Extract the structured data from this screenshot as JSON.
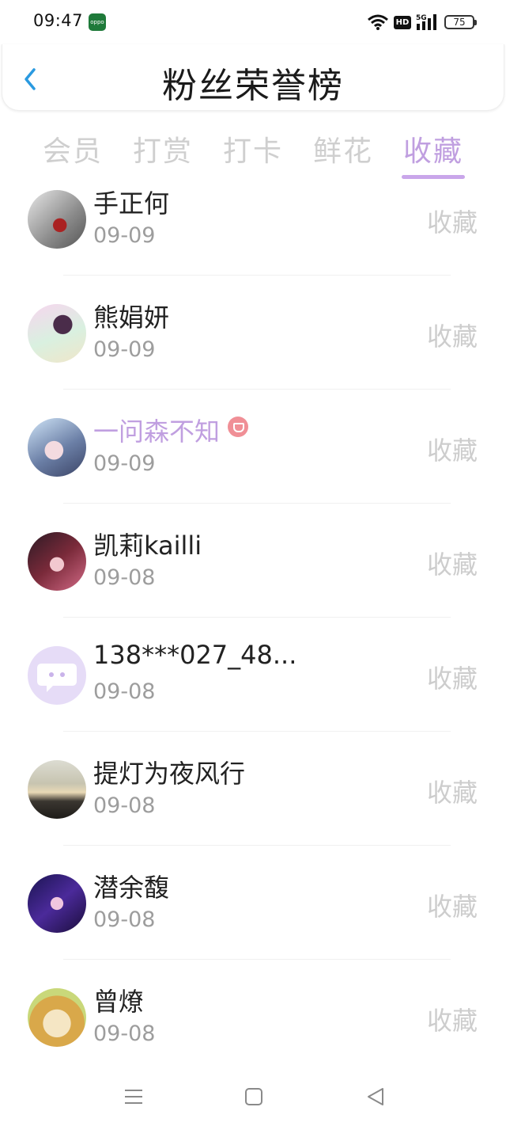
{
  "status_bar": {
    "time": "09:47",
    "app_icon_text": "oppo",
    "hd_label": "HD",
    "network": "5G",
    "battery": "75"
  },
  "header": {
    "title": "粉丝荣誉榜",
    "back_icon": "chevron-left-icon"
  },
  "tabs": [
    {
      "label": "会员",
      "active": false
    },
    {
      "label": "打赏",
      "active": false
    },
    {
      "label": "打卡",
      "active": false
    },
    {
      "label": "鲜花",
      "active": false
    },
    {
      "label": "收藏",
      "active": true
    }
  ],
  "colors": {
    "accent": "#c09fe0",
    "muted": "#cdcdcd",
    "date": "#9d9d9d"
  },
  "list": [
    {
      "name": "手正何",
      "date": "09-09",
      "action": "收藏",
      "vip": false
    },
    {
      "name": "熊娟妍",
      "date": "09-09",
      "action": "收藏",
      "vip": false
    },
    {
      "name": "一问森不知",
      "date": "09-09",
      "action": "收藏",
      "vip": true
    },
    {
      "name": "凯莉kailli",
      "date": "09-08",
      "action": "收藏",
      "vip": false
    },
    {
      "name": "138***027_48...",
      "date": "09-08",
      "action": "收藏",
      "vip": false
    },
    {
      "name": "提灯为夜风行",
      "date": "09-08",
      "action": "收藏",
      "vip": false
    },
    {
      "name": "潜余馥",
      "date": "09-08",
      "action": "收藏",
      "vip": false
    },
    {
      "name": "曾燎",
      "date": "09-08",
      "action": "收藏",
      "vip": false
    }
  ],
  "nav_bar": {
    "menu_icon": "menu-icon",
    "home_icon": "home-square-icon",
    "back_icon": "back-triangle-icon"
  }
}
